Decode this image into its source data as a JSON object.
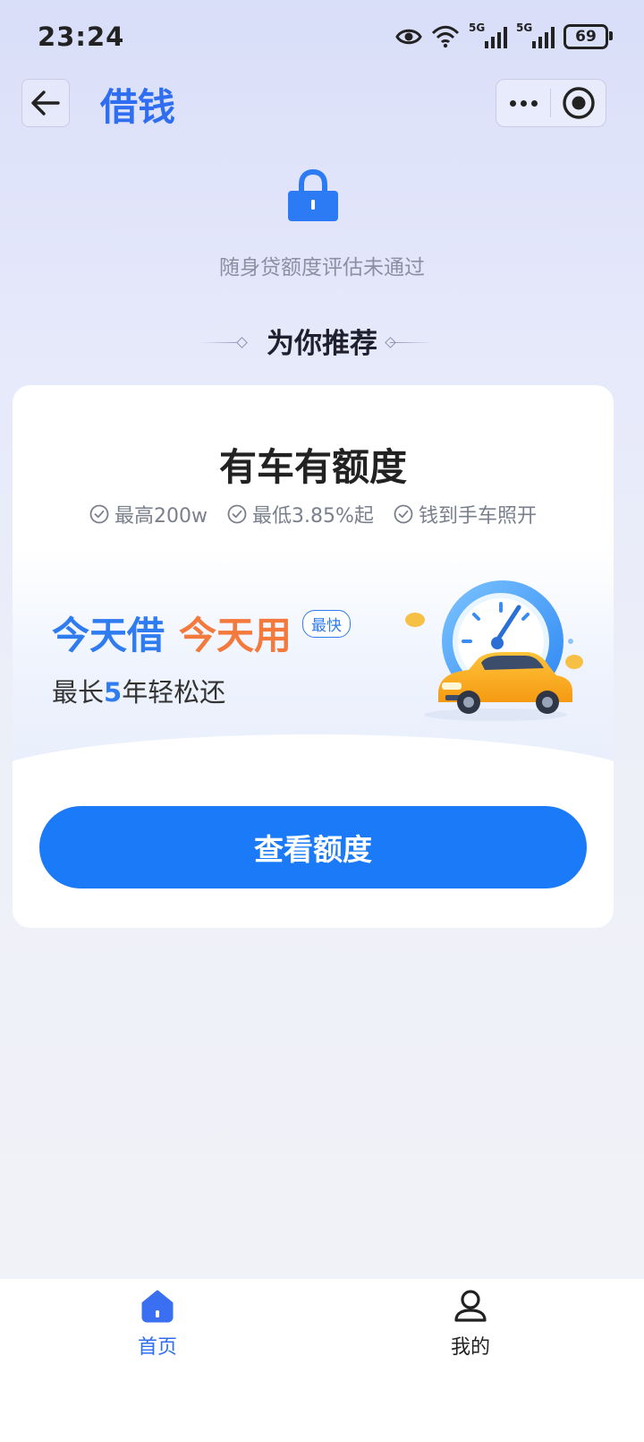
{
  "status_bar": {
    "time": "23:24",
    "network_1": "5G",
    "network_2": "5G",
    "battery": "69"
  },
  "header": {
    "title": "借钱"
  },
  "notice": {
    "text": "随身贷额度评估未通过"
  },
  "recommend": {
    "title": "为你推荐"
  },
  "card": {
    "title": "有车有额度",
    "features": [
      {
        "text": "最高200w"
      },
      {
        "text": "最低3.85%起"
      },
      {
        "text": "钱到手车照开"
      }
    ],
    "slogan_part1": "今天借",
    "slogan_part2": "今天用",
    "tag": "最快",
    "sub_prefix": "最长",
    "sub_highlight": "5",
    "sub_suffix": "年轻松还",
    "cta_label": "查看额度"
  },
  "tabbar": {
    "items": [
      {
        "label": "首页",
        "active": true
      },
      {
        "label": "我的",
        "active": false
      }
    ]
  },
  "colors": {
    "accent": "#2f6ef0",
    "button": "#1a7af8",
    "orange": "#f37a3c"
  }
}
